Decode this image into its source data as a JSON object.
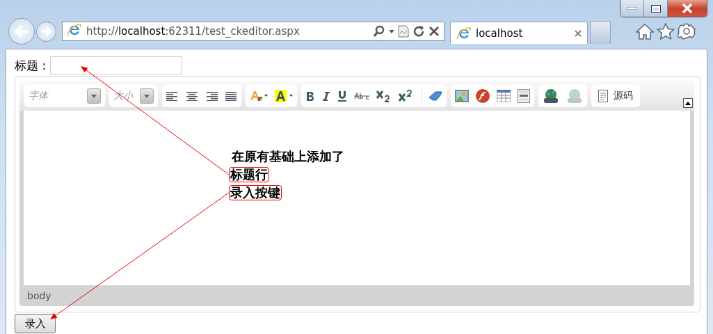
{
  "browser": {
    "address": {
      "scheme": "http://",
      "host": "localhost",
      "rest": ":62311/test_ckeditor.aspx"
    },
    "tabs": [
      {
        "label": "localhost",
        "selected": true
      }
    ]
  },
  "page": {
    "title_label": "标题：",
    "editor": {
      "font_combo": {
        "placeholder": "字体"
      },
      "size_combo": {
        "placeholder": "大小"
      },
      "source_button": "源码",
      "content": [
        {
          "text": "在原有基础上添加了",
          "highlighted": false
        },
        {
          "text": "标题行",
          "highlighted": true
        },
        {
          "text": "录入按键",
          "highlighted": true
        }
      ],
      "status_path": "body"
    },
    "submit_button": "录入"
  }
}
